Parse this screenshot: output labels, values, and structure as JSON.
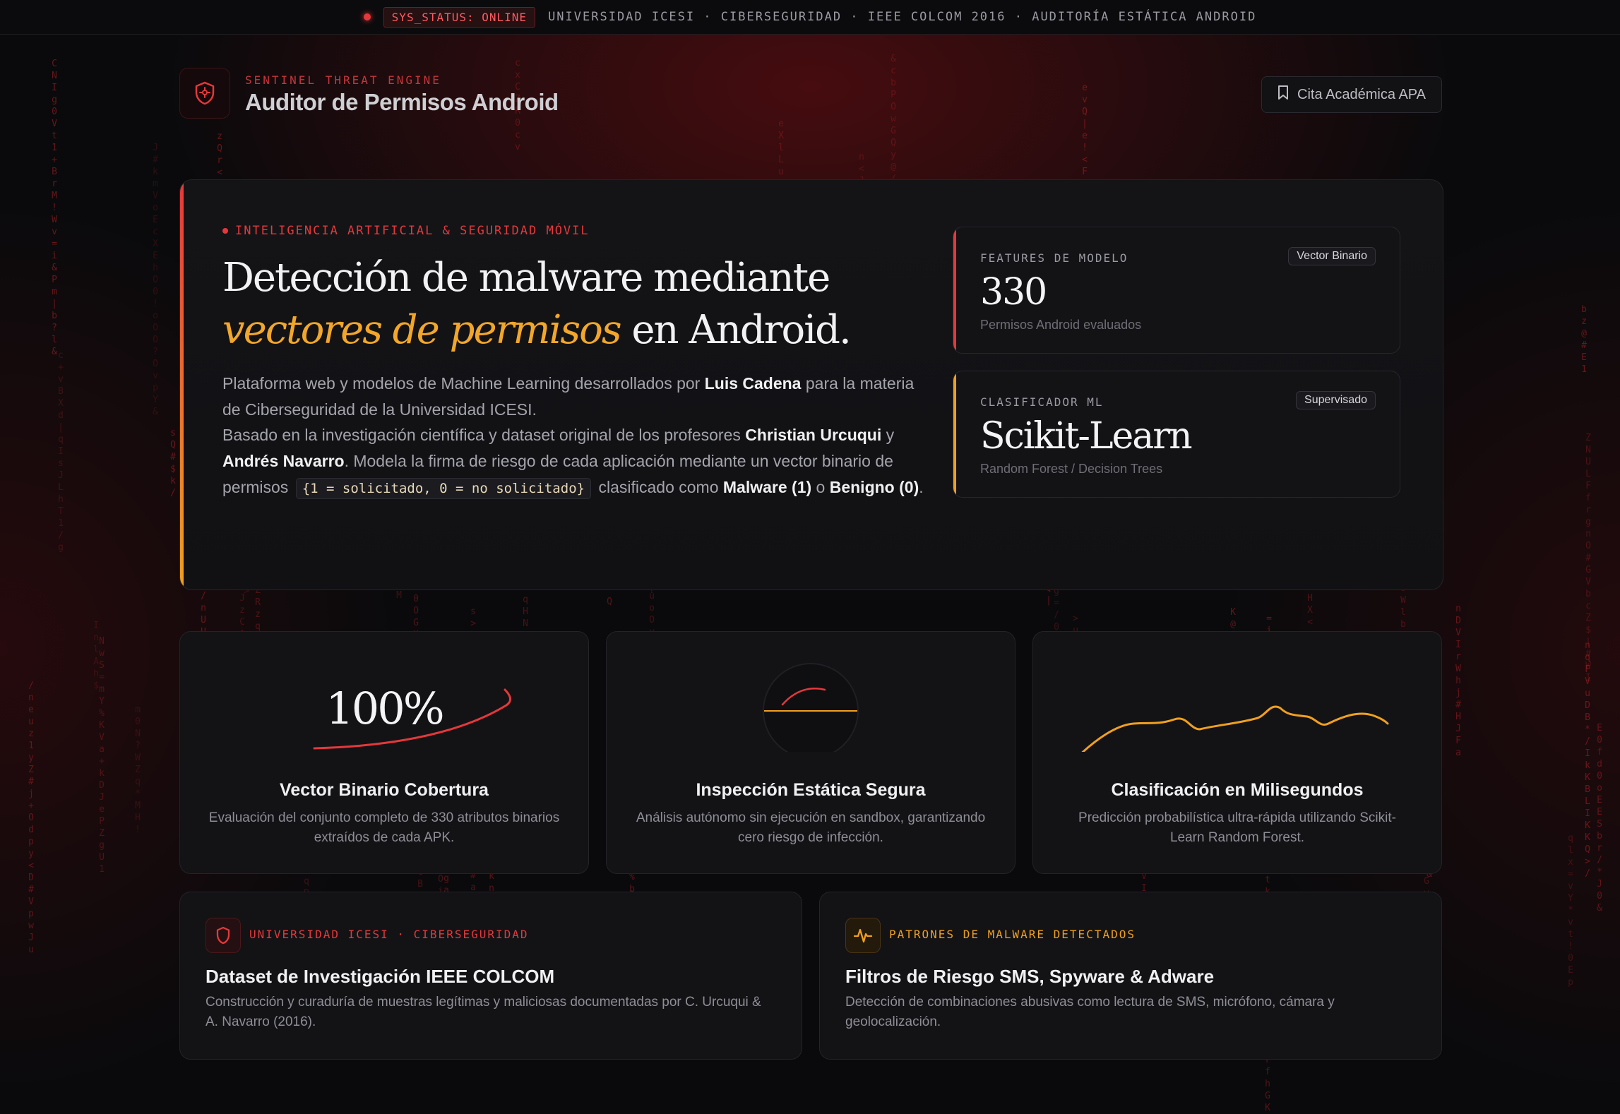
{
  "topbar": {
    "status": "SYS_STATUS: ONLINE",
    "breadcrumb": "UNIVERSIDAD ICESI · CIBERSEGURIDAD · IEEE COLCOM 2016 · AUDITORÍA ESTÁTICA ANDROID"
  },
  "header": {
    "kicker": "SENTINEL THREAT ENGINE",
    "title": "Auditor de Permisos Android",
    "cite_button": "Cita Académica APA",
    "icons": {
      "brand": "shield-icon",
      "cite": "bookmark-icon"
    }
  },
  "hero": {
    "kicker": "INTELIGENCIA ARTIFICIAL & SEGURIDAD MÓVIL",
    "title_pre": "Detección de malware mediante ",
    "title_highlight": "vectores de permisos",
    "title_post": " en Android.",
    "p1_a": "Plataforma web y modelos de Machine Learning desarrollados por ",
    "p1_author": "Luis Cadena",
    "p1_b": " para la materia de Ciberseguridad de la Universidad ICESI.",
    "p2_a": "Basado en la investigación científica y dataset original de los profesores ",
    "p2_prof1": "Christian Urcuqui",
    "p2_and": " y ",
    "p2_prof2": "Andrés Navarro",
    "p2_b": ". Modela la firma de riesgo de cada aplicación mediante un vector binario de permisos ",
    "p2_code": "{1 = solicitado, 0 = no solicitado}",
    "p2_c": " clasificado como ",
    "p2_malware": "Malware (1)",
    "p2_or": " o ",
    "p2_benign": "Benigno (0)",
    "p2_end": "."
  },
  "stats": [
    {
      "label": "FEATURES DE MODELO",
      "tag": "Vector Binario",
      "value": "330",
      "sub": "Permisos Android evaluados",
      "accent": "#e5383b"
    },
    {
      "label": "CLASIFICADOR ML",
      "tag": "Supervisado",
      "value": "Scikit-Learn",
      "sub": "Random Forest / Decision Trees",
      "accent": "#f0a020"
    }
  ],
  "features": [
    {
      "visual_text": "100%",
      "title": "Vector Binario Cobertura",
      "desc": "Evaluación del conjunto completo de 330 atributos binarios extraídos de cada APK."
    },
    {
      "title": "Inspección Estática Segura",
      "desc": "Análisis autónomo sin ejecución en sandbox, garantizando cero riesgo de infección."
    },
    {
      "title": "Clasificación en Milisegundos",
      "desc": "Predicción probabilística ultra-rápida utilizando Scikit-Learn Random Forest."
    }
  ],
  "bottom_cards": [
    {
      "icon": "shield-icon",
      "kicker": "UNIVERSIDAD ICESI · CIBERSEGURIDAD",
      "title": "Dataset de Investigación IEEE COLCOM",
      "desc": "Construcción y curaduría de muestras legítimas y maliciosas documentadas por C. Urcuqui & A. Navarro (2016).",
      "accent": "#e5383b"
    },
    {
      "icon": "activity-icon",
      "kicker": "PATRONES DE MALWARE DETECTADOS",
      "title": "Filtros de Riesgo SMS, Spyware & Adware",
      "desc": "Detección de combinaciones abusivas como lectura de SMS, micrófono, cámara y geolocalización.",
      "accent": "#f0a020"
    }
  ],
  "colors": {
    "red": "#e5383b",
    "amber": "#f0a020",
    "background": "#0a0a0c",
    "card": "#131316"
  }
}
